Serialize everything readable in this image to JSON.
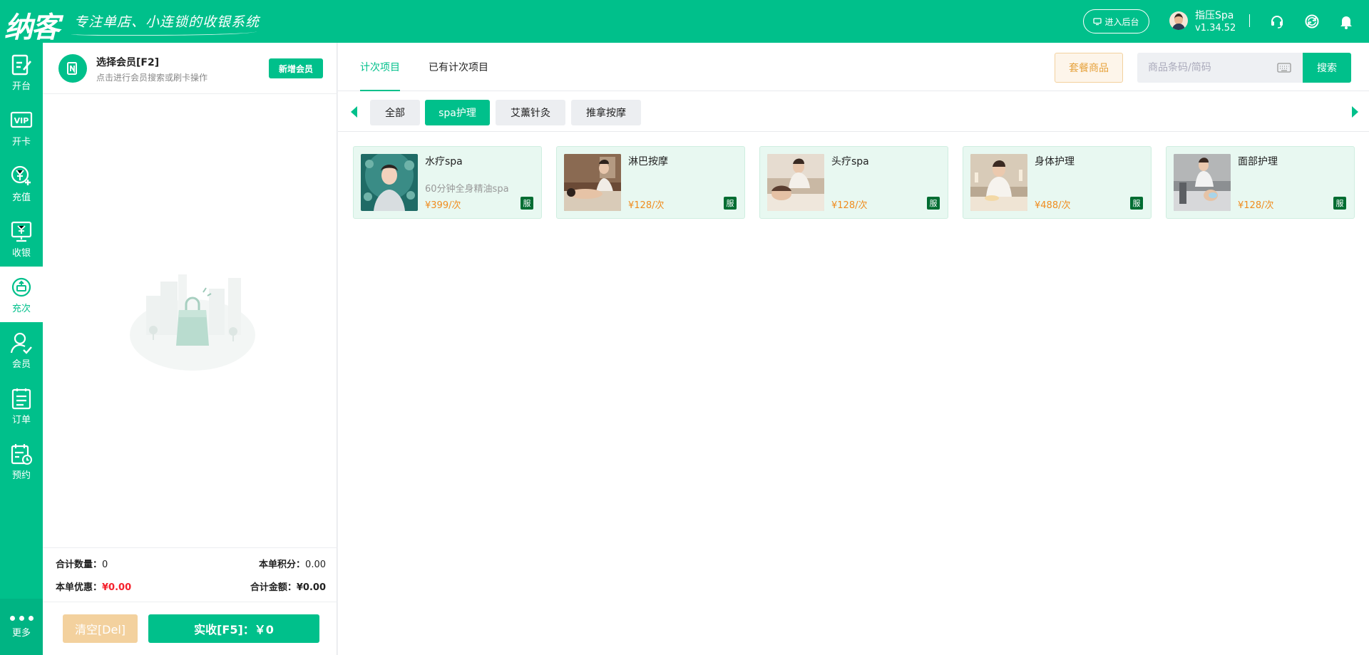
{
  "header": {
    "logo_text": "纳客",
    "slogan": "专注单店、小连锁的收银系统",
    "backend_button": "进入后台",
    "user_name": "指压Spa",
    "version": "v1.34.52"
  },
  "sidenav": {
    "items": [
      {
        "label": "开台",
        "icon": "edit-table-icon"
      },
      {
        "label": "开卡",
        "icon": "vip-card-icon"
      },
      {
        "label": "充值",
        "icon": "yen-plus-icon"
      },
      {
        "label": "收银",
        "icon": "cashier-monitor-icon"
      },
      {
        "label": "充次",
        "icon": "recharge-times-icon"
      },
      {
        "label": "会员",
        "icon": "member-check-icon"
      },
      {
        "label": "订单",
        "icon": "order-list-icon"
      },
      {
        "label": "预约",
        "icon": "appointment-calendar-icon"
      }
    ],
    "active_index": 4,
    "more_label": "更多"
  },
  "member": {
    "title": "选择会员[F2]",
    "subtitle": "点击进行会员搜索或刷卡操作",
    "new_button": "新增会员"
  },
  "summary": {
    "total_qty_label": "合计数量：",
    "total_qty": "0",
    "points_label": "本单积分：",
    "points": "0.00",
    "discount_label": "本单优惠：",
    "discount": "¥0.00",
    "total_amount_label": "合计金额：",
    "total_amount": "¥0.00",
    "clear_button": "清空[Del]",
    "pay_button": "实收[F5]：￥0"
  },
  "main": {
    "tabs": [
      "计次项目",
      "已有计次项目"
    ],
    "active_tab": 0,
    "package_button": "套餐商品",
    "search_placeholder": "商品条码/简码",
    "search_button": "搜索",
    "categories": [
      "全部",
      "spa护理",
      "艾薰针灸",
      "推拿按摩"
    ],
    "active_category": 1,
    "products": [
      {
        "name": "水疗spa",
        "desc": "60分钟全身精油spa",
        "price": "¥399/次",
        "badge": "服"
      },
      {
        "name": "淋巴按摩",
        "desc": "",
        "price": "¥128/次",
        "badge": "服"
      },
      {
        "name": "头疗spa",
        "desc": "",
        "price": "¥128/次",
        "badge": "服"
      },
      {
        "name": "身体护理",
        "desc": "",
        "price": "¥488/次",
        "badge": "服"
      },
      {
        "name": "面部护理",
        "desc": "",
        "price": "¥128/次",
        "badge": "服"
      }
    ]
  },
  "colors": {
    "brand": "#00c08b",
    "price": "#f08c1e",
    "discount": "#f5222d",
    "package": "#e6a23c"
  }
}
